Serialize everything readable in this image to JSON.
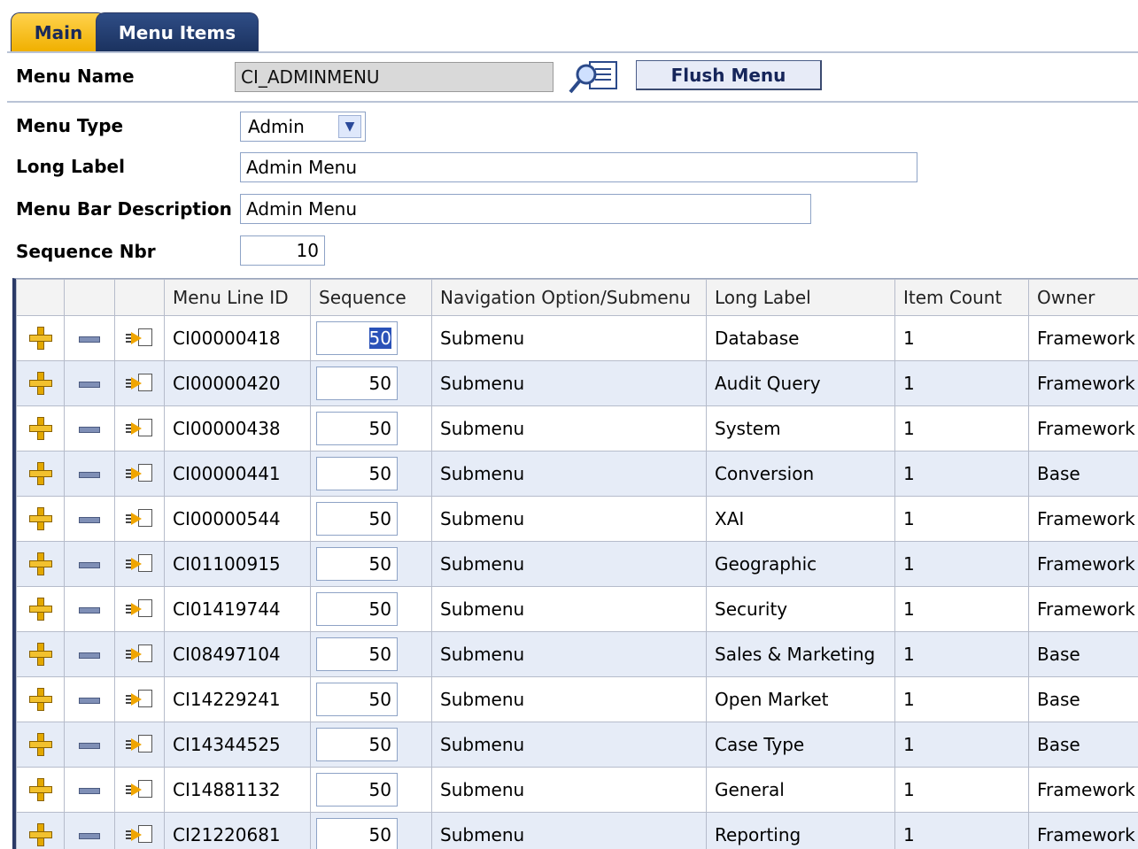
{
  "tabs": [
    {
      "label": "Main"
    },
    {
      "label": "Menu Items"
    }
  ],
  "header": {
    "menu_name_label": "Menu Name",
    "menu_name_value": "CI_ADMINMENU",
    "flush_button": "Flush Menu"
  },
  "form": {
    "menu_type_label": "Menu Type",
    "menu_type_value": "Admin",
    "long_label_label": "Long Label",
    "long_label_value": "Admin Menu",
    "menu_bar_desc_label": "Menu Bar Description",
    "menu_bar_desc_value": "Admin Menu",
    "sequence_label": "Sequence Nbr",
    "sequence_value": "10"
  },
  "grid": {
    "columns": [
      "",
      "",
      "",
      "Menu Line ID",
      "Sequence",
      "Navigation Option/Submenu",
      "Long Label",
      "Item Count",
      "Owner"
    ],
    "rows": [
      {
        "id": "CI00000418",
        "seq": "50",
        "nav": "Submenu",
        "label": "Database",
        "count": "1",
        "owner": "Framework"
      },
      {
        "id": "CI00000420",
        "seq": "50",
        "nav": "Submenu",
        "label": "Audit Query",
        "count": "1",
        "owner": "Framework"
      },
      {
        "id": "CI00000438",
        "seq": "50",
        "nav": "Submenu",
        "label": "System",
        "count": "1",
        "owner": "Framework"
      },
      {
        "id": "CI00000441",
        "seq": "50",
        "nav": "Submenu",
        "label": "Conversion",
        "count": "1",
        "owner": "Base"
      },
      {
        "id": "CI00000544",
        "seq": "50",
        "nav": "Submenu",
        "label": "XAI",
        "count": "1",
        "owner": "Framework"
      },
      {
        "id": "CI01100915",
        "seq": "50",
        "nav": "Submenu",
        "label": "Geographic",
        "count": "1",
        "owner": "Framework"
      },
      {
        "id": "CI01419744",
        "seq": "50",
        "nav": "Submenu",
        "label": "Security",
        "count": "1",
        "owner": "Framework"
      },
      {
        "id": "CI08497104",
        "seq": "50",
        "nav": "Submenu",
        "label": "Sales & Marketing",
        "count": "1",
        "owner": "Base"
      },
      {
        "id": "CI14229241",
        "seq": "50",
        "nav": "Submenu",
        "label": "Open Market",
        "count": "1",
        "owner": "Base"
      },
      {
        "id": "CI14344525",
        "seq": "50",
        "nav": "Submenu",
        "label": "Case Type",
        "count": "1",
        "owner": "Base"
      },
      {
        "id": "CI14881132",
        "seq": "50",
        "nav": "Submenu",
        "label": "General",
        "count": "1",
        "owner": "Framework"
      },
      {
        "id": "CI21220681",
        "seq": "50",
        "nav": "Submenu",
        "label": "Reporting",
        "count": "1",
        "owner": "Framework"
      }
    ]
  }
}
